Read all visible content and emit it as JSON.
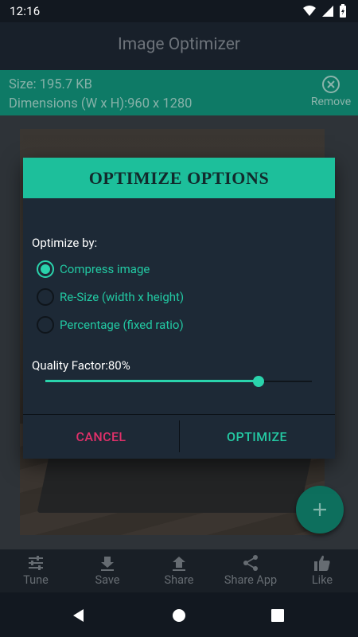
{
  "status_bar": {
    "time": "12:16"
  },
  "app_bar": {
    "title": "Image Optimizer"
  },
  "info": {
    "size": "Size: 195.7 KB",
    "dimensions": "Dimensions (W x H):960 x 1280",
    "remove_label": "Remove"
  },
  "dialog": {
    "title": "OPTIMIZE OPTIONS",
    "optimize_by_label": "Optimize by:",
    "options": [
      {
        "label": "Compress image",
        "checked": true
      },
      {
        "label": "Re-Size (width x height)",
        "checked": false
      },
      {
        "label": "Percentage (fixed ratio)",
        "checked": false
      }
    ],
    "quality_label": "Quality Factor:80%",
    "quality_value": 80,
    "cancel_label": "CANCEL",
    "optimize_label": "OPTIMIZE"
  },
  "bottom_nav": [
    {
      "label": "Tune",
      "icon": "tune-icon"
    },
    {
      "label": "Save",
      "icon": "download-icon"
    },
    {
      "label": "Share",
      "icon": "upload-icon"
    },
    {
      "label": "Share App",
      "icon": "share-icon"
    },
    {
      "label": "Like",
      "icon": "thumb-up-icon"
    }
  ],
  "colors": {
    "accent": "#1dbf9b",
    "cancel": "#e2306a",
    "dialog_bg": "#1d2936"
  }
}
